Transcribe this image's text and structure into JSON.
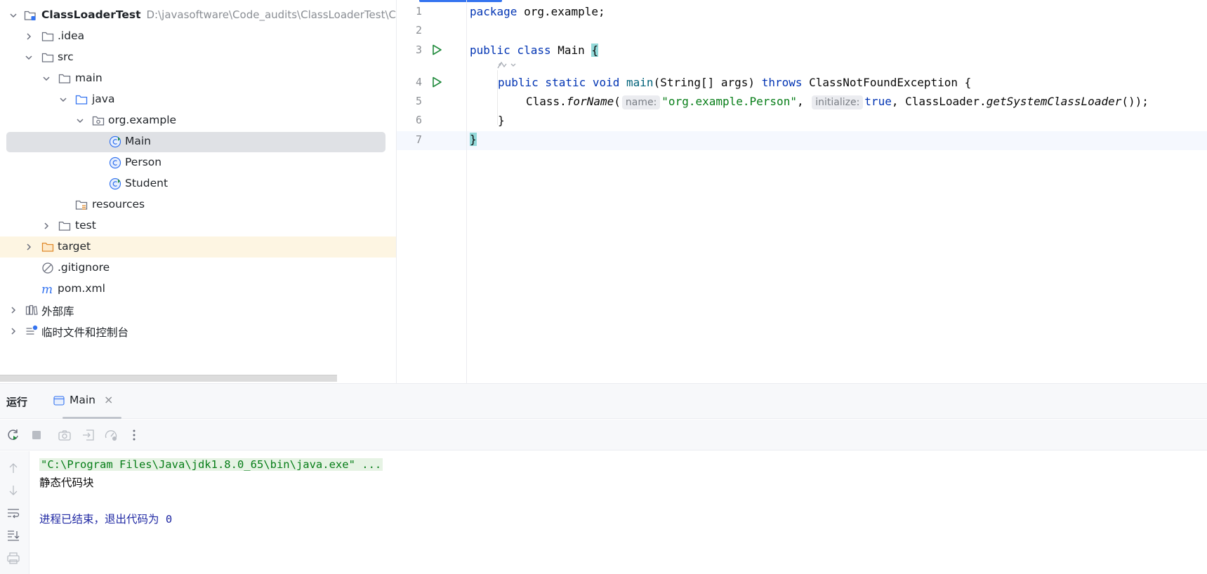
{
  "project_tree": {
    "root": {
      "name": "ClassLoaderTest",
      "path": "D:\\javasoftware\\Code_audits\\ClassLoaderTest\\ClassL"
    },
    "items": [
      {
        "label": ".idea"
      },
      {
        "label": "src"
      },
      {
        "label": "main"
      },
      {
        "label": "java"
      },
      {
        "label": "org.example"
      },
      {
        "label": "Main"
      },
      {
        "label": "Person"
      },
      {
        "label": "Student"
      },
      {
        "label": "resources"
      },
      {
        "label": "test"
      },
      {
        "label": "target"
      },
      {
        "label": ".gitignore"
      },
      {
        "label": "pom.xml"
      },
      {
        "label": "外部库"
      },
      {
        "label": "临时文件和控制台"
      }
    ]
  },
  "editor": {
    "line_numbers": [
      "1",
      "2",
      "3",
      "4",
      "5",
      "6",
      "7"
    ],
    "code": {
      "l1_kw": "package",
      "l1_rest": " org.example;",
      "l3_kw": "public class",
      "l3_name": " Main ",
      "l3_brace": "{",
      "l4_kw1": "public static void",
      "l4_fn": "main",
      "l4_mid": "(String[] args) ",
      "l4_kw2": "throws",
      "l4_rest": " ClassNotFoundException {",
      "l5_class": "Class.",
      "l5_method": "forName",
      "l5_open": "(",
      "l5_hint1": "name:",
      "l5_str": "\"org.example.Person\"",
      "l5_comma": ", ",
      "l5_hint2": "initialize:",
      "l5_true": "true",
      "l5_cl": ", ClassLoader.",
      "l5_getcl": "getSystemClassLoader",
      "l5_end": "());",
      "l6": "}",
      "l7": "}"
    }
  },
  "run_window": {
    "title": "运行",
    "tab_label": "Main",
    "tab_close": "×",
    "console": {
      "command": "\"C:\\Program Files\\Java\\jdk1.8.0_65\\bin\\java.exe\" ...",
      "output": "静态代码块",
      "exit": "进程已结束，退出代码为 0"
    }
  },
  "colors": {
    "keyword": "#0033b3",
    "string": "#067d17",
    "selection": "#dfe1e5",
    "accent": "#3574f0",
    "run_green": "#208a3c"
  },
  "icons": [
    "chevron-right-icon",
    "chevron-down-icon",
    "folder-icon",
    "module-icon",
    "source-folder-icon",
    "package-icon",
    "java-class-icon",
    "resources-folder-icon",
    "excluded-folder-icon",
    "ignore-file-icon",
    "maven-icon",
    "library-icon",
    "scratches-icon",
    "run-gutter-icon",
    "rerun-icon",
    "stop-icon",
    "camera-icon",
    "exit-icon",
    "profiler-icon",
    "more-icon",
    "arrow-up-icon",
    "arrow-down-icon",
    "soft-wrap-icon",
    "scroll-end-icon",
    "print-icon"
  ]
}
